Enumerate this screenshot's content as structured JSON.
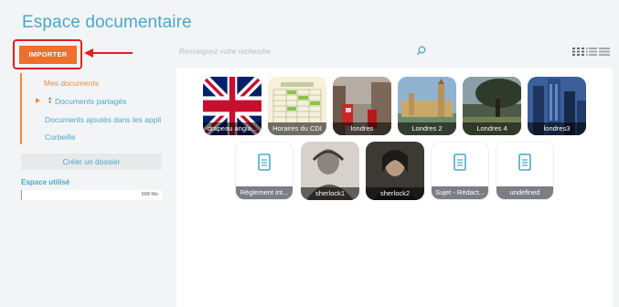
{
  "header": {
    "title": "Espace documentaire"
  },
  "toolbar": {
    "import_label": "IMPORTER",
    "search_placeholder": "Renseignez votre recherche"
  },
  "sidebar": {
    "my_documents": "Mes documents",
    "shared_documents": "Documents partagés",
    "added_in_apps": "Documents ajoutés dans les appli",
    "trash": "Corbeille",
    "create_folder": "Créer un dossier",
    "space_used_label": "Espace utilisé",
    "space_used_value": "999 Mo"
  },
  "files": [
    {
      "name": "drapeau angla...",
      "icon": "flag-image"
    },
    {
      "name": "Horaires du CDI",
      "icon": "timetable-image"
    },
    {
      "name": "londres",
      "icon": "street-photo"
    },
    {
      "name": "Londres 2",
      "icon": "parliament-photo"
    },
    {
      "name": "Londres 4",
      "icon": "tree-photo"
    },
    {
      "name": "londres3",
      "icon": "skyline-photo"
    },
    {
      "name": "Règlement int...",
      "icon": "document-icon"
    },
    {
      "name": "sherlock1",
      "icon": "portrait-photo"
    },
    {
      "name": "sherlock2",
      "icon": "portrait-photo"
    },
    {
      "name": "Sujet - Rédact...",
      "icon": "document-icon"
    },
    {
      "name": "undefined",
      "icon": "document-icon"
    }
  ],
  "colors": {
    "accent": "#4aa8c9",
    "import_button": "#ef6f2c",
    "highlight_box": "#e02020",
    "nav_active": "#f08a3c"
  }
}
